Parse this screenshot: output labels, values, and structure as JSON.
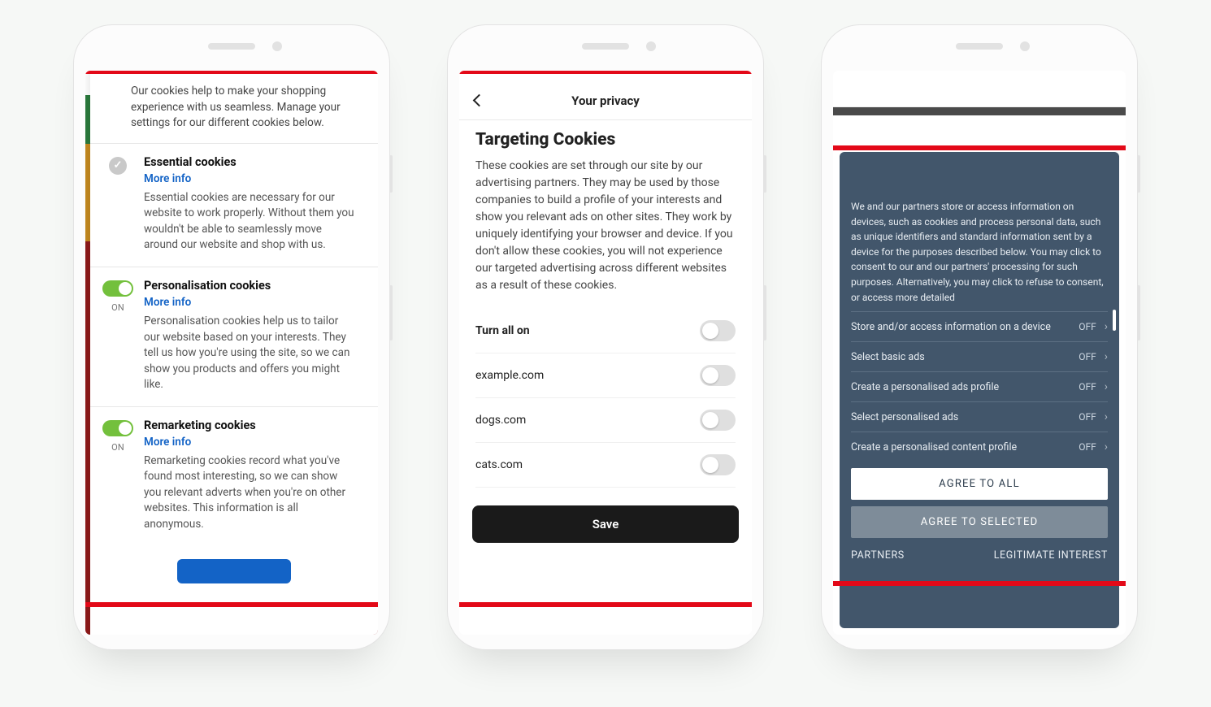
{
  "phone1": {
    "intro": "Our cookies help to make your shopping experience with us seamless. Manage your settings for our different cookies below.",
    "sections": [
      {
        "kind": "locked",
        "title": "Essential cookies",
        "link": "More info",
        "desc": "Essential cookies are necessary for our website to work properly. Without them you wouldn't be able to seamlessly move around our website and shop with us."
      },
      {
        "kind": "toggle",
        "state": "ON",
        "title": "Personalisation cookies",
        "link": "More info",
        "desc": "Personalisation cookies help us to tailor our website based on your interests. They tell us how you're using the site, so we can show you products and offers you might like."
      },
      {
        "kind": "toggle",
        "state": "ON",
        "title": "Remarketing cookies",
        "link": "More info",
        "desc": "Remarketing cookies record what you've found most interesting, so we can show you relevant adverts when you're on other websites. This information is all anonymous."
      }
    ]
  },
  "phone2": {
    "header": "Your privacy",
    "heading": "Targeting Cookies",
    "body": "These cookies are set through our site by our advertising partners. They may be used by those companies to build a profile of your interests and show you relevant ads on other sites. They work by uniquely identifying your browser and device. If you don't allow these cookies, you will not experience our targeted advertising across different websites as a result of these cookies.",
    "rows": [
      "Turn all on",
      "example.com",
      "dogs.com",
      "cats.com"
    ],
    "save": "Save"
  },
  "phone3": {
    "intro": "We and our partners store or access information on devices, such as cookies and process personal data, such as unique identifiers and standard information sent by a device for the purposes described below. You may click to consent to our and our partners' processing for such purposes. Alternatively, you may click to refuse to consent, or access more detailed",
    "off": "OFF",
    "rows": [
      "Store and/or access information on a device",
      "Select basic ads",
      "Create a personalised ads profile",
      "Select personalised ads",
      "Create a personalised content profile"
    ],
    "agree_all": "AGREE TO ALL",
    "agree_sel": "AGREE TO SELECTED",
    "partners": "PARTNERS",
    "legit": "LEGITIMATE INTEREST"
  }
}
